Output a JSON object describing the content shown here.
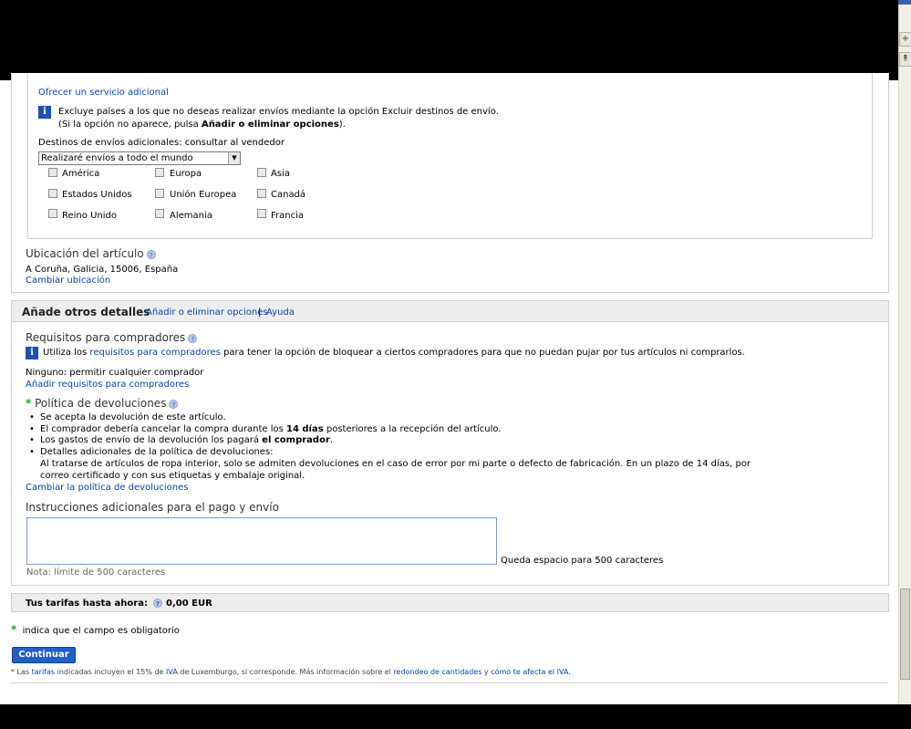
{
  "colors": {
    "link": "#0645ad",
    "button": "#1f5fc8",
    "required_star": "#2a9a2a",
    "panel_header": "#ededed"
  },
  "shipping": {
    "offer_link": "Ofrecer un servicio adicional",
    "info_line1": "Excluye países a los que no deseas realizar envíos mediante la opción Excluir destinos de envío.",
    "info_line2_prefix": "(Si la opción no aparece, pulsa ",
    "info_line2_bold": "Añadir o eliminar opciones",
    "info_line2_suffix": ").",
    "destinations_label": "Destinos de envíos adicionales: consultar al vendedor",
    "select_value": "Realizaré envíos a todo el mundo",
    "checkboxes": [
      "América",
      "Europa",
      "Asia",
      "Estados Unidos",
      "Unión Europea",
      "Canadá",
      "Reino Unido",
      "Alemania",
      "Francia"
    ],
    "location_title": "Ubicación del artículo",
    "location_value": "A Coruña, Galicia, 15006, España",
    "change_location": "Cambiar ubicación"
  },
  "details": {
    "header_title": "Añade otros detalles",
    "header_link_options": "Añadir o eliminar opciones",
    "header_separator": "|",
    "header_link_help": "Ayuda",
    "buyer_req_title": "Requisitos para compradores",
    "buyer_req_info_prefix": "Utiliza los ",
    "buyer_req_info_link": "requisitos para compradores",
    "buyer_req_info_suffix": " para tener la opción de bloquear a ciertos compradores para que no puedan pujar por tus artículos ni comprarlos.",
    "buyer_req_value": "Ninguno: permitir cualquier comprador",
    "buyer_req_link": "Añadir requisitos para compradores",
    "returns_star": "*",
    "returns_title": "Política de devoluciones",
    "returns_b1": "Se acepta la devolución de este artículo.",
    "returns_b2_prefix": "El comprador debería cancelar la compra durante los ",
    "returns_b2_bold": "14 días",
    "returns_b2_suffix": " posteriores a la recepción del artículo.",
    "returns_b3_prefix": "Los gastos de envío de la devolución los pagará ",
    "returns_b3_bold": "el comprador",
    "returns_b3_suffix": ".",
    "returns_b4": "Detalles adicionales de la política de devoluciones:",
    "returns_detail_line1": "Al tratarse de artículos de ropa interior, solo se admiten devoluciones en el caso de error por mi parte o defecto de fabricación. En un plazo de 14 días, por",
    "returns_detail_line2": "correo certificado y con sus etiquetas y embalaje original.",
    "returns_change_link": "Cambiar la política de devoluciones",
    "instructions_title": "Instrucciones adicionales para el pago y envío",
    "instructions_value": "",
    "remaining_text": "Queda espacio para 500 caracteres",
    "limit_note": "Nota: límite de 500 caracteres"
  },
  "fees": {
    "label": "Tus tarifas hasta ahora:",
    "value": "0,00 EUR"
  },
  "required_note": {
    "star": "*",
    "text": "indica que el campo es obligatorio"
  },
  "continue_button": "Continuar",
  "footnote": {
    "p1": "* Las ",
    "tarifas": "tarifas",
    "p2": " indicadas incluyen el 15% de ",
    "iva": "IVA",
    "p3": " de Luxemburgo, si corresponde. Más información sobre el ",
    "redondeo": "redondeo de cantidades",
    "p4": " y ",
    "afecta": "cómo te afecta el IVA",
    "p5": "."
  }
}
